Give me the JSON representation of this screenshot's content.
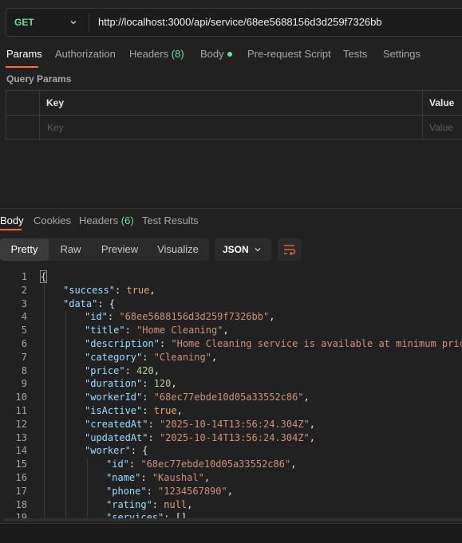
{
  "request": {
    "method": "GET",
    "url": "http://localhost:3000/api/service/68ee5688156d3d259f7326bb"
  },
  "request_tabs": {
    "params": "Params",
    "authorization": "Authorization",
    "headers": "Headers",
    "headers_count": "(8)",
    "body": "Body",
    "prerequest": "Pre-request Script",
    "tests": "Tests",
    "settings": "Settings"
  },
  "query_params": {
    "title": "Query Params",
    "col_key": "Key",
    "col_value": "Value",
    "placeholder_key": "Key",
    "placeholder_value": "Value"
  },
  "response_tabs": {
    "body": "Body",
    "cookies": "Cookies",
    "headers": "Headers",
    "headers_count": "(6)",
    "test_results": "Test Results"
  },
  "view_modes": {
    "pretty": "Pretty",
    "raw": "Raw",
    "preview": "Preview",
    "visualize": "Visualize"
  },
  "format": "JSON",
  "code": {
    "line_numbers": [
      "1",
      "2",
      "3",
      "4",
      "5",
      "6",
      "7",
      "8",
      "9",
      "10",
      "11",
      "12",
      "13",
      "14",
      "15",
      "16",
      "17",
      "18",
      "19"
    ],
    "brace_open": "{",
    "success_key": "\"success\"",
    "success_val": "true",
    "data_key": "\"data\"",
    "id_key": "\"id\"",
    "id_val": "\"68ee5688156d3d259f7326bb\"",
    "title_key": "\"title\"",
    "title_val": "\"Home Cleaning\"",
    "description_key": "\"description\"",
    "description_val": "\"Home Cleaning service is available at minimum price\"",
    "category_key": "\"category\"",
    "category_val": "\"Cleaning\"",
    "price_key": "\"price\"",
    "price_val": "420",
    "duration_key": "\"duration\"",
    "duration_val": "120",
    "workerId_key": "\"workerId\"",
    "workerId_val": "\"68ec77ebde10d05a33552c86\"",
    "isActive_key": "\"isActive\"",
    "isActive_val": "true",
    "createdAt_key": "\"createdAt\"",
    "createdAt_val": "\"2025-10-14T13:56:24.304Z\"",
    "updatedAt_key": "\"updatedAt\"",
    "updatedAt_val": "\"2025-10-14T13:56:24.304Z\"",
    "worker_key": "\"worker\"",
    "worker_id_key": "\"id\"",
    "worker_id_val": "\"68ec77ebde10d05a33552c86\"",
    "worker_name_key": "\"name\"",
    "worker_name_val": "\"Kaushal\"",
    "worker_phone_key": "\"phone\"",
    "worker_phone_val": "\"1234567890\"",
    "worker_rating_key": "\"rating\"",
    "worker_rating_val": "null",
    "worker_services_key": "\"services\"",
    "worker_services_val": "[]"
  },
  "colors": {
    "accent": "#ff6c37",
    "method_green": "#6bdd9a",
    "key": "#9cdcfe",
    "string": "#ce9178",
    "number": "#b5cea8"
  }
}
